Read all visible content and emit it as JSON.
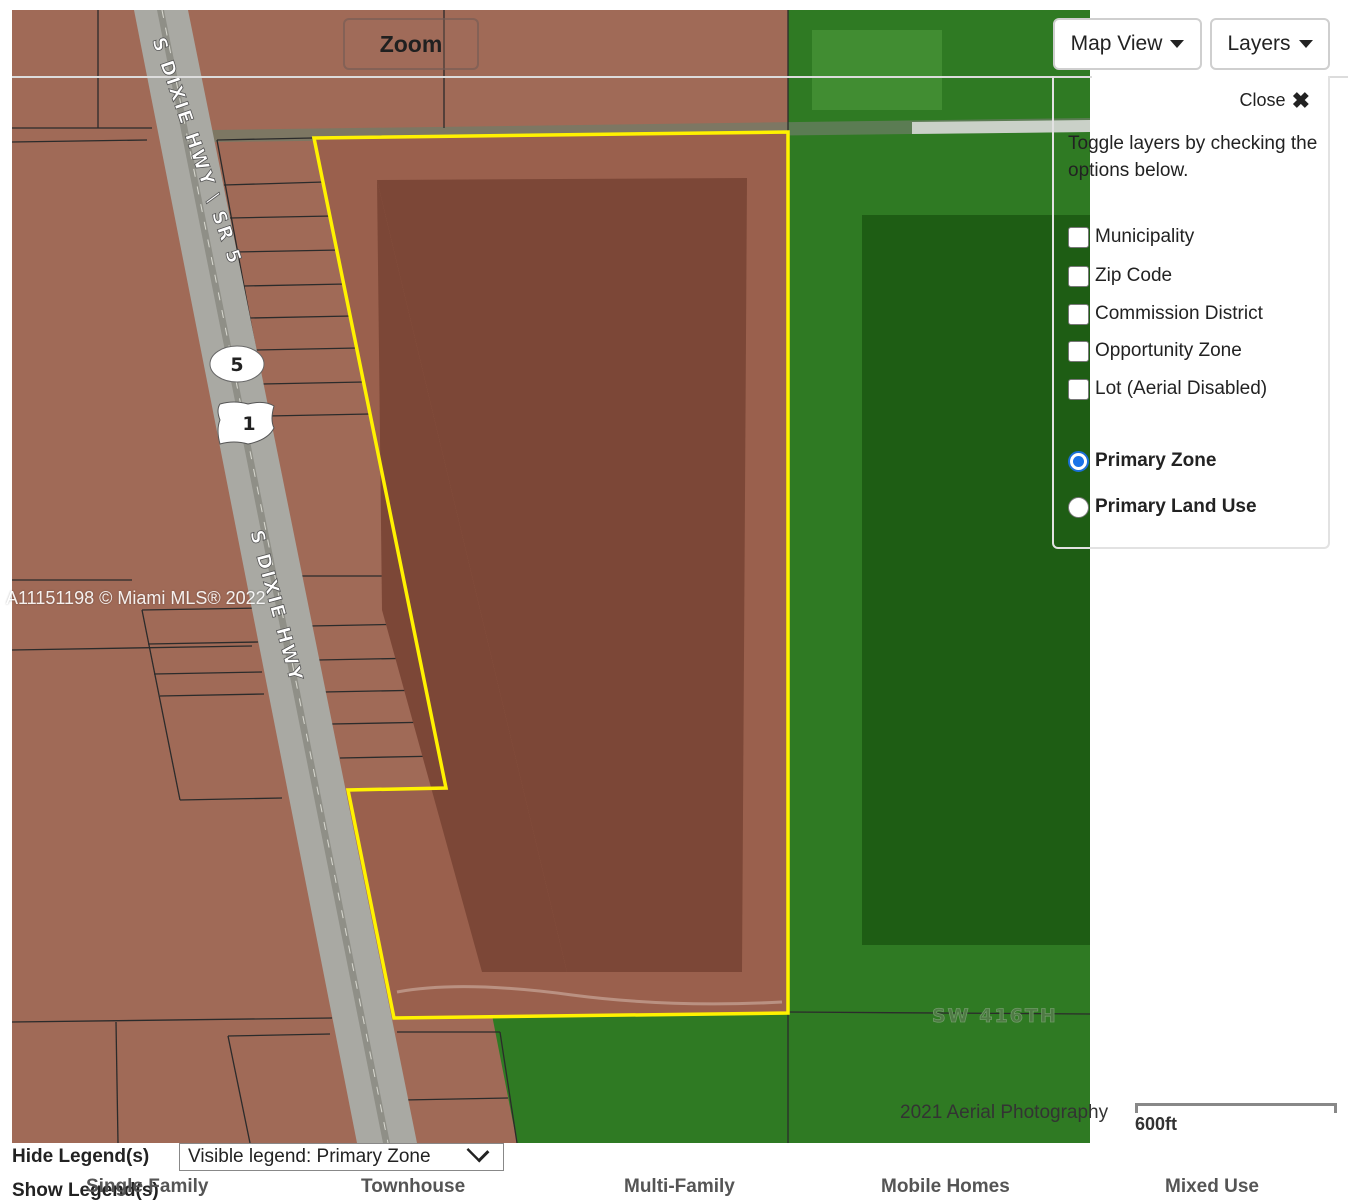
{
  "map": {
    "colors": {
      "residential_zone": "#a06a57",
      "parcel_pond": "#7c4737",
      "agricultural_zone": "#2f7a23",
      "agricultural_dark": "#1e5d14",
      "highlight": "#fff200",
      "road": "#a9a9a3"
    },
    "road_labels": [
      "S DIXIE HWY \\ SR 5",
      "S DIXIE HWY",
      "SW 416TH"
    ],
    "shields": [
      "5",
      "1"
    ],
    "watermark": "A11151198 © Miami MLS® 2022",
    "attribution": "2021 Aerial Photography",
    "scale_label": "600ft"
  },
  "toolbar": {
    "zoom_label": "Zoom",
    "map_view_label": "Map View",
    "layers_label": "Layers"
  },
  "layers_panel": {
    "close_label": "Close",
    "intro": "Toggle layers by checking the options below.",
    "checkboxes": [
      {
        "label": "Municipality",
        "checked": false
      },
      {
        "label": "Zip Code",
        "checked": false
      },
      {
        "label": "Commission District",
        "checked": false
      },
      {
        "label": "Opportunity Zone",
        "checked": false
      },
      {
        "label": "Lot (Aerial Disabled)",
        "checked": false
      }
    ],
    "radios": [
      {
        "label": "Primary Zone",
        "selected": true
      },
      {
        "label": "Primary Land Use",
        "selected": false
      }
    ]
  },
  "legend": {
    "hide_label": "Hide Legend(s)",
    "show_label": "Show Legend(s)",
    "visible_select": "Visible legend: Primary Zone",
    "categories": [
      "Single Family",
      "Townhouse",
      "Multi-Family",
      "Mobile Homes",
      "Mixed Use"
    ]
  }
}
